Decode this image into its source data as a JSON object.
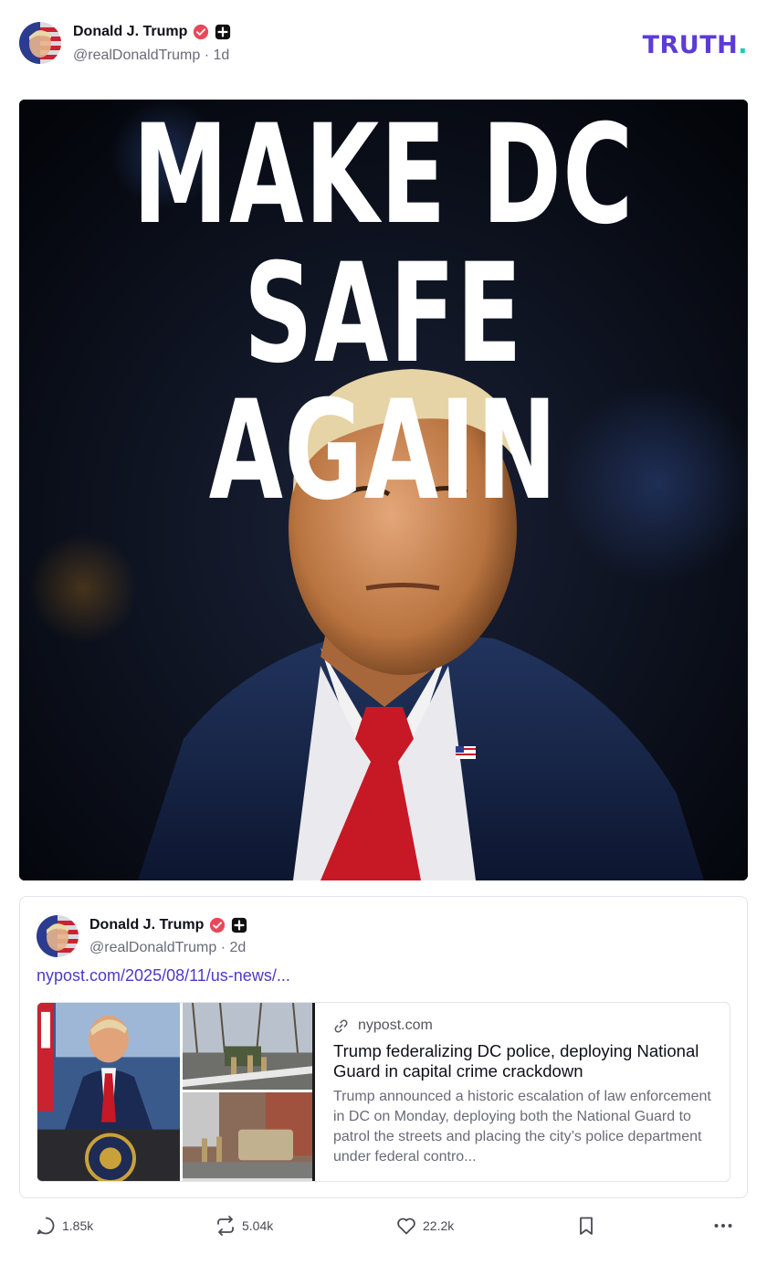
{
  "post": {
    "author": {
      "display_name": "Donald J. Trump",
      "handle": "@realDonaldTrump",
      "time_ago": "1d",
      "meta": "@realDonaldTrump · 1d"
    },
    "brand": "TRUTH",
    "image": {
      "headline_line1": "MAKE DC",
      "headline_line2": "SAFE AGAIN"
    }
  },
  "quoted_post": {
    "author": {
      "display_name": "Donald J. Trump",
      "handle": "@realDonaldTrump",
      "time_ago": "2d",
      "meta": "@realDonaldTrump · 2d"
    },
    "link_text": "nypost.com/2025/08/11/us-news/...",
    "link_card": {
      "domain": "nypost.com",
      "title": "Trump federalizing DC police, deploying National Guard in capital crime crackdown",
      "description": "Trump announced a historic escalation of law enforcement in DC on Monday, deploying both the National Guard to patrol the streets and placing the city’s police department under federal contro..."
    }
  },
  "actions": {
    "replies": "1.85k",
    "retruths": "5.04k",
    "likes": "22.2k"
  },
  "icons": {
    "verified": "verified-badge-icon",
    "plus": "plus-badge-icon",
    "reply": "reply-icon",
    "retruth": "retruth-icon",
    "like": "heart-icon",
    "bookmark": "bookmark-icon",
    "more": "more-icon",
    "link": "link-icon"
  },
  "colors": {
    "brand_purple": "#5c3bd8",
    "brand_teal": "#1ec8b7",
    "verified_red": "#e8485a",
    "link_color": "#4b3bc6"
  }
}
